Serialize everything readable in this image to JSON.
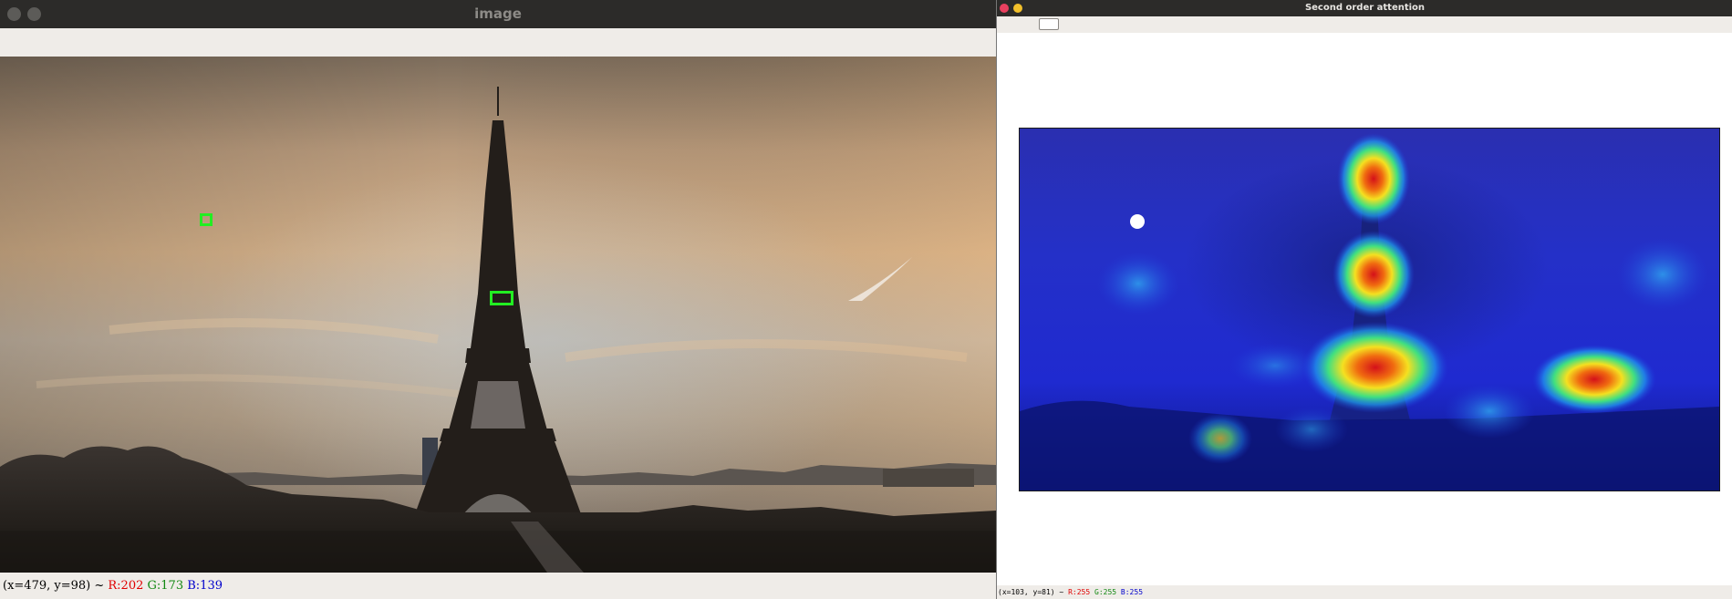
{
  "left_window": {
    "title": "image",
    "status": {
      "coords": "(x=479, y=98) ~",
      "r": "R:202",
      "g": "G:173",
      "b": "B:139"
    },
    "markers": {
      "color": "#22ee22",
      "count": 2
    }
  },
  "right_window": {
    "title": "Second order attention",
    "status": {
      "coords": "(x=103, y=81) ~",
      "r": "R:255",
      "g": "G:255",
      "b": "B:255"
    }
  },
  "colors": {
    "titlebar": "#2c2b29",
    "toolbar": "#efece8",
    "close_button": "#e9405f",
    "minimize_button": "#f2c02b",
    "heatmap_low": "#1f2ad0",
    "heatmap_high": "#d4101a"
  },
  "icons": [
    "close-icon",
    "minimize-icon"
  ]
}
